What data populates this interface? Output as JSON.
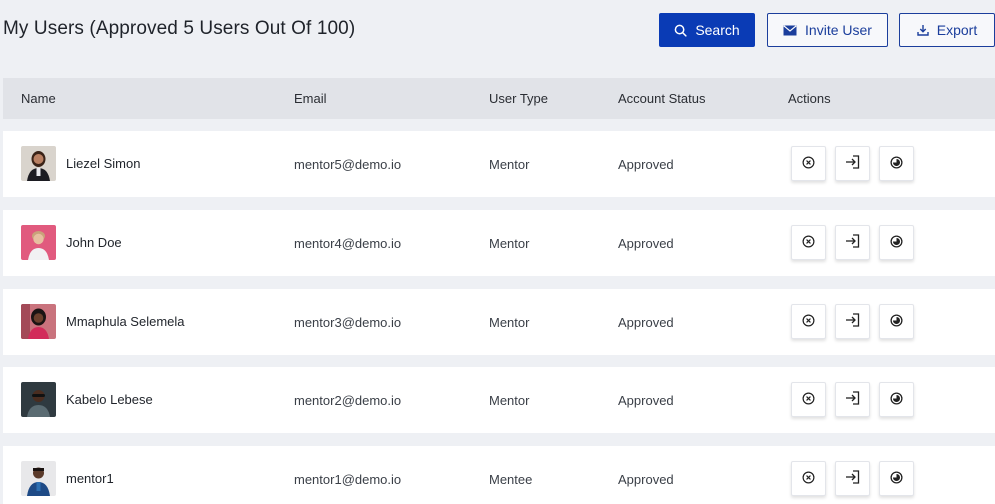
{
  "page": {
    "title": "My Users (Approved 5 Users Out Of 100)"
  },
  "toolbar": {
    "search_label": "Search",
    "invite_label": "Invite User",
    "export_label": "Export"
  },
  "table": {
    "columns": [
      "Name",
      "Email",
      "User Type",
      "Account Status",
      "Actions"
    ],
    "rows": [
      {
        "name": "Liezel Simon",
        "email": "mentor5@demo.io",
        "user_type": "Mentor",
        "status": "Approved"
      },
      {
        "name": "John Doe",
        "email": "mentor4@demo.io",
        "user_type": "Mentor",
        "status": "Approved"
      },
      {
        "name": "Mmaphula Selemela",
        "email": "mentor3@demo.io",
        "user_type": "Mentor",
        "status": "Approved"
      },
      {
        "name": "Kabelo Lebese",
        "email": "mentor2@demo.io",
        "user_type": "Mentor",
        "status": "Approved"
      },
      {
        "name": "mentor1",
        "email": "mentor1@demo.io",
        "user_type": "Mentee",
        "status": "Approved"
      }
    ]
  },
  "icons": {
    "search": "search-icon",
    "invite": "envelope-icon",
    "export": "download-icon",
    "reject": "close-circle-icon",
    "login_as": "login-icon",
    "toggle": "toggle-icon"
  },
  "colors": {
    "primary": "#0a3bb5",
    "outline": "#1b3e9c",
    "header_bg": "#e1e3e8",
    "page_bg": "#eef0f4"
  }
}
